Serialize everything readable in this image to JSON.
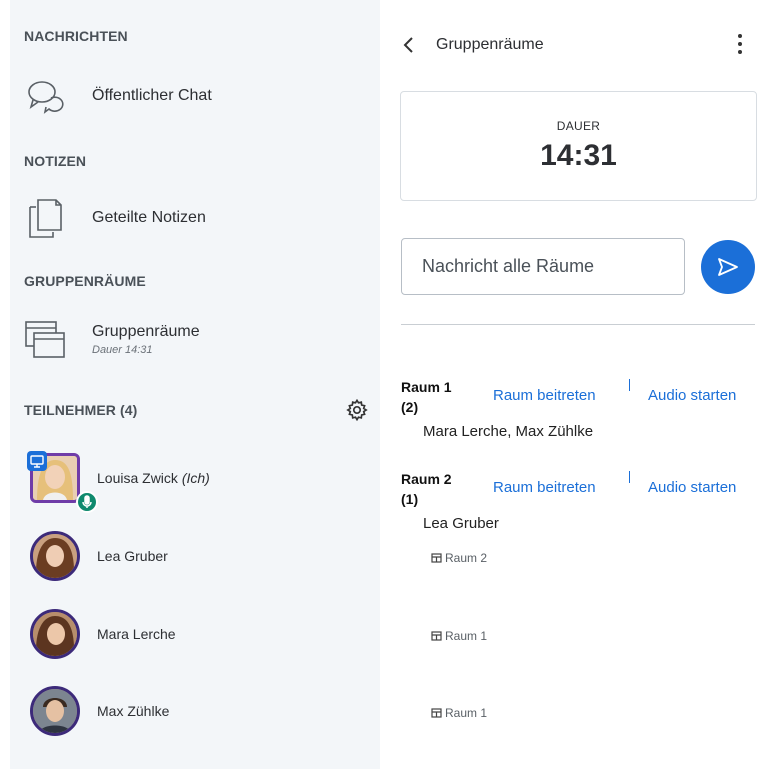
{
  "sidebar": {
    "messages": {
      "title": "NACHRICHTEN",
      "item_label": "Öffentlicher Chat"
    },
    "notes": {
      "title": "NOTIZEN",
      "item_label": "Geteilte Notizen"
    },
    "breakouts": {
      "title": "GRUPPENRÄUME",
      "item_label": "Gruppenräume",
      "item_sub": "Dauer 14:31"
    },
    "participants": {
      "title": "TEILNEHMER (4)",
      "users": [
        {
          "name": "Louisa Zwick",
          "suffix": "(Ich)",
          "room": ""
        },
        {
          "name": "Lea Gruber",
          "room": "Raum 2"
        },
        {
          "name": "Mara Lerche",
          "room": "Raum 1"
        },
        {
          "name": "Max Zühlke",
          "room": "Raum 1"
        }
      ]
    }
  },
  "panel": {
    "title": "Gruppenräume",
    "duration_label": "DAUER",
    "duration_value": "14:31",
    "message_placeholder": "Nachricht alle Räume",
    "rooms": [
      {
        "name": "Raum 1 (2)",
        "join_label": "Raum beitreten",
        "audio_label": "Audio starten",
        "members": "Mara Lerche, Max Zühlke"
      },
      {
        "name": "Raum 2 (1)",
        "join_label": "Raum beitreten",
        "audio_label": "Audio starten",
        "members": "Lea Gruber"
      }
    ]
  },
  "colors": {
    "accent": "#1b6fd8",
    "sidebar_bg": "#f3f6f9",
    "mic_badge": "#0f8a6e"
  }
}
